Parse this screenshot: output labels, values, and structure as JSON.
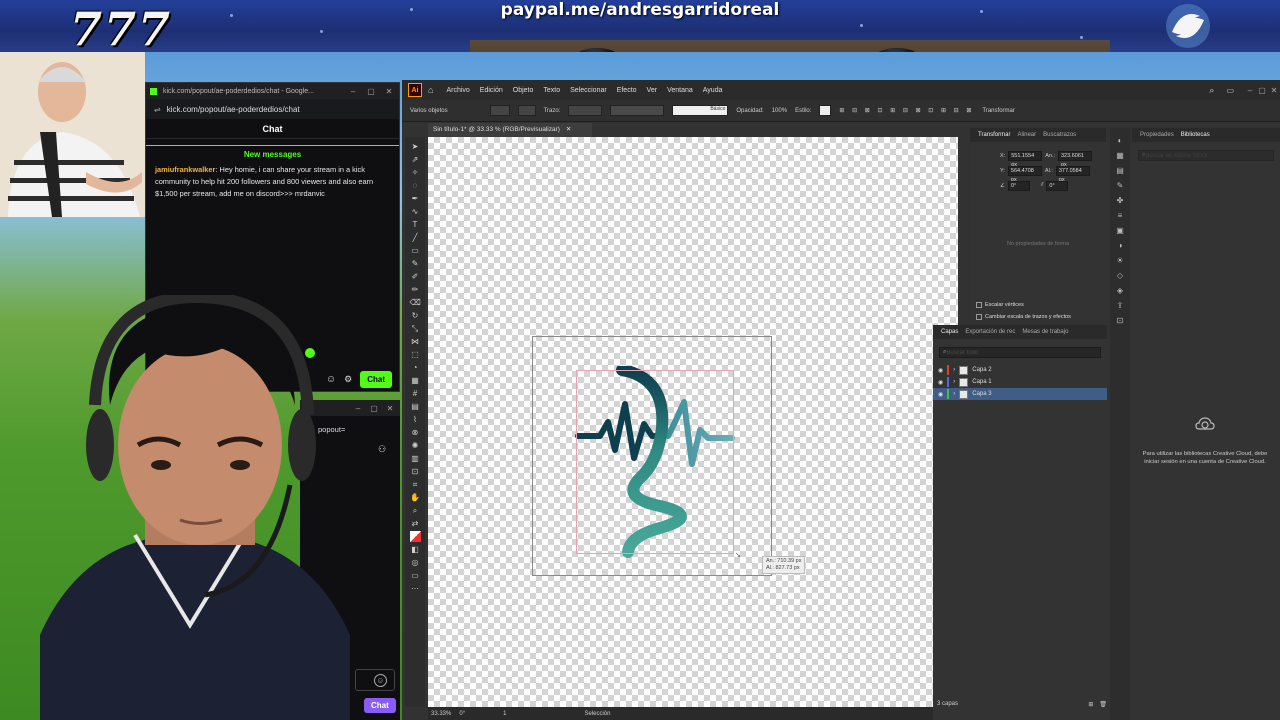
{
  "overlay": {
    "brand_777": "777",
    "paypal_text": "paypal.me/andresgarridoreal"
  },
  "chat_window": {
    "title": "kick.com/popout/ae-poderdedios/chat - Google...",
    "url": "kick.com/popout/ae-poderdedios/chat",
    "header": "Chat",
    "new_messages": "New messages",
    "message": {
      "user": "jamiufrankwalker",
      "text": ": Hey homie, i can share your stream in a kick community to help hit 200 followers and 800 viewers and also earn $1,500 per stream, add me on discord>>> mrdanvic"
    },
    "chat_button": "Chat"
  },
  "chat_window_2": {
    "url_fragment": "popout=",
    "chat_button": "Chat"
  },
  "illustrator": {
    "menu": [
      "Archivo",
      "Edición",
      "Objeto",
      "Texto",
      "Seleccionar",
      "Efecto",
      "Ver",
      "Ventana",
      "Ayuda"
    ],
    "control_bar": {
      "selection_label": "Varios objetos",
      "stroke_label": "Trazo:",
      "stroke_style": "Básico",
      "opacity_label": "Opacidad:",
      "opacity_value": "100%",
      "style_label": "Estilo:",
      "transform_label": "Transformar"
    },
    "document_tab": "Sin título-1* @ 33.33 % (RGB/Previsualizar)",
    "size_tooltip": {
      "width": "An.: 710.39 px",
      "height": "Al.: 827.73 px"
    },
    "status_bar": {
      "zoom": "33.33%",
      "rotation": "0°",
      "artboard": "1",
      "tool": "Selección"
    },
    "transform_panel": {
      "tabs": [
        "Transformar",
        "Alinear",
        "Buscatrazos"
      ],
      "x": "551.1554 px",
      "y": "564.4708 px",
      "w_label": "An.:",
      "w": "323.6061 px",
      "h_label": "Al.:",
      "h": "377.0584 px",
      "rotate": "0°",
      "shear": "0°",
      "no_properties": "No propiedades de forma",
      "scale_corners": "Escalar vértices",
      "scale_strokes": "Cambiar escala de trazos y efectos"
    },
    "layers_panel": {
      "tabs": [
        "Capas",
        "Exportación de rec",
        "Mesas de trabajo"
      ],
      "search_placeholder": "Buscar todo",
      "layers": [
        {
          "name": "Capa 2",
          "color": "#e03c3c",
          "selected": false
        },
        {
          "name": "Capa 1",
          "color": "#4f6be0",
          "selected": false
        },
        {
          "name": "Capa 3",
          "color": "#3ec33e",
          "selected": true
        }
      ],
      "footer": "3 capas"
    },
    "right_panel": {
      "tabs": [
        "Propiedades",
        "Bibliotecas"
      ],
      "search_placeholder": "Buscar en Adobe Stock",
      "cc_message": "Para utilizar las bibliotecas Creative Cloud, debe iniciar sesión en una cuenta de Creative Cloud."
    }
  },
  "colors": {
    "kick_green": "#53fc18",
    "logo_dark": "#0e3f4f",
    "logo_teal": "#2f8b83",
    "logo_light": "#5aa8b0",
    "selection_blue": "#3f5d86"
  }
}
